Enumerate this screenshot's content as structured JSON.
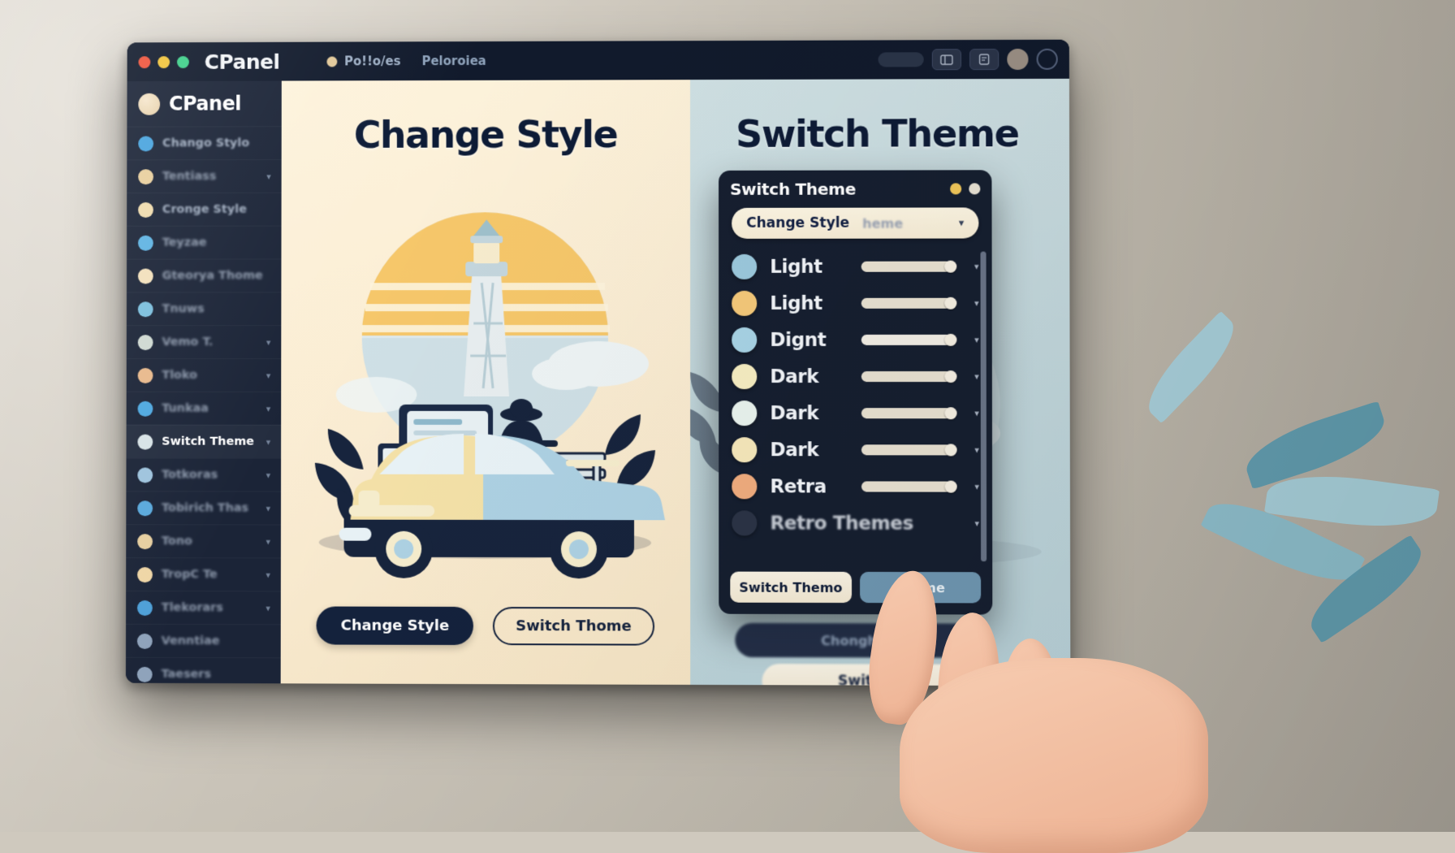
{
  "window": {
    "title": "CPanel",
    "traffic_lights": [
      "close-red",
      "minimize-yellow",
      "maximize-green"
    ],
    "menu": [
      {
        "label": "Po!!o/es",
        "icon": "dot-icon"
      },
      {
        "label": "Peloroiea",
        "icon": "none"
      }
    ],
    "toolbar_icons": [
      "pill-indicator",
      "panel-icon",
      "note-icon",
      "camera-icon",
      "profile-circle-icon"
    ]
  },
  "sidebar": {
    "brand": "CPanel",
    "brand_icon": "avatar-circle-icon",
    "items": [
      {
        "label": "Chango Stylo",
        "color": "#49a4de",
        "chevron": false,
        "blur": "low",
        "selected": false
      },
      {
        "label": "Tentiass",
        "color": "#e8cf9e",
        "chevron": true,
        "blur": "mid",
        "selected": false
      },
      {
        "label": "Cronge Style",
        "color": "#f0dcae",
        "chevron": false,
        "blur": "low",
        "selected": false
      },
      {
        "label": "Teyzae",
        "color": "#5fb3e2",
        "chevron": false,
        "blur": "mid",
        "selected": false
      },
      {
        "label": "Gteorya Thome",
        "color": "#f2e0bc",
        "chevron": false,
        "blur": "mid",
        "selected": false
      },
      {
        "label": "Tnuws",
        "color": "#7cbfdd",
        "chevron": false,
        "blur": "mid",
        "selected": false
      },
      {
        "label": "Vemo T.",
        "color": "#cfd9d2",
        "chevron": true,
        "blur": "mid",
        "selected": false
      },
      {
        "label": "Tloko",
        "color": "#e8b98c",
        "chevron": true,
        "blur": "mid",
        "selected": false
      },
      {
        "label": "Tunkaa",
        "color": "#4ea8e0",
        "chevron": true,
        "blur": "mid",
        "selected": false
      },
      {
        "label": "Switch Theme",
        "color": "#d8e3e6",
        "chevron": true,
        "blur": "none",
        "selected": true
      },
      {
        "label": "Totkoras",
        "color": "#9ec3dd",
        "chevron": true,
        "blur": "mid",
        "selected": false
      },
      {
        "label": "Tobirich Thas",
        "color": "#5aa9dc",
        "chevron": true,
        "blur": "mid",
        "selected": false
      },
      {
        "label": "Tono",
        "color": "#e7cfa0",
        "chevron": true,
        "blur": "mid",
        "selected": false
      },
      {
        "label": "TropC Te",
        "color": "#efd6a6",
        "chevron": true,
        "blur": "mid",
        "selected": false
      },
      {
        "label": "Tlekorars",
        "color": "#4ea0d8",
        "chevron": true,
        "blur": "mid",
        "selected": false
      },
      {
        "label": "Venntiae",
        "color": "#8fa3bb",
        "chevron": false,
        "blur": "mid",
        "selected": false
      },
      {
        "label": "Taesers",
        "color": "#8fa3bb",
        "chevron": false,
        "blur": "mid",
        "selected": false
      }
    ]
  },
  "left_pane": {
    "heading": "Change Style",
    "illustration": "retro-car-lighthouse-desk-scene",
    "buttons": [
      {
        "label": "Change Style",
        "style": "solid"
      },
      {
        "label": "Switch Thome",
        "style": "outline"
      }
    ]
  },
  "right_pane": {
    "heading": "Switch Theme",
    "dialog": {
      "title": "Switch Theme",
      "window_dots": [
        "#f0c75a",
        "#e8e2d4"
      ],
      "select": {
        "value": "Change Style",
        "ghost_text": "heme",
        "caret": "chevron-down-icon"
      },
      "themes": [
        {
          "name": "Light",
          "swatch": "#9cc9dd",
          "slider": "full",
          "blur": false
        },
        {
          "name": "Light",
          "swatch": "#f5c97a",
          "slider": "full",
          "blur": false
        },
        {
          "name": "Dignt",
          "swatch": "#a8d4e6",
          "slider": "light",
          "blur": false
        },
        {
          "name": "Dark",
          "swatch": "#f7eec2",
          "slider": "full",
          "blur": false
        },
        {
          "name": "Dark",
          "swatch": "#eaf4ef",
          "slider": "full",
          "blur": false
        },
        {
          "name": "Dark",
          "swatch": "#f7e9bc",
          "slider": "full",
          "blur": false
        },
        {
          "name": "Retra",
          "swatch": "#f2ad7f",
          "slider": "full",
          "blur": false
        },
        {
          "name": "Retro Themes",
          "swatch": "#2b3446",
          "slider": "none",
          "blur": true
        }
      ],
      "actions": [
        {
          "label": "Switch Themo",
          "style": "primary"
        },
        {
          "label": "Thame",
          "style": "ghost"
        }
      ]
    },
    "ghost_buttons": [
      {
        "label": "Chonghns"
      },
      {
        "label": "Switch"
      }
    ]
  },
  "colors": {
    "window_chrome": "#111a2c",
    "sidebar_bg": "#1b2437",
    "left_pane_bg": "#fdf3dc",
    "right_pane_bg": "#cfe0e3",
    "dialog_bg": "#161f30",
    "accent_cream": "#fbf5e6",
    "heading": "#0d1b36"
  }
}
